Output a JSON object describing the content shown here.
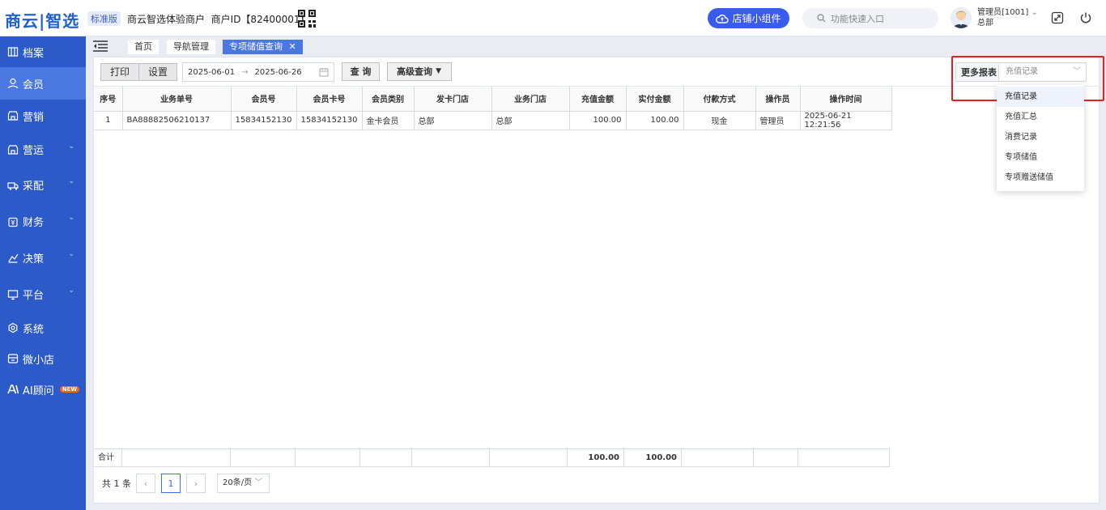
{
  "header": {
    "logo": "商云|智选",
    "edition": "标准版",
    "merchant_name": "商云智选体验商户",
    "merchant_id": "商户ID【82400001】",
    "shop_widget_label": "店铺小组件",
    "quick_search_placeholder": "功能快速入口",
    "user_name": "管理员[1001]",
    "user_dept": "总部"
  },
  "sidebar": {
    "items": [
      {
        "label": "档案",
        "icon": "archive-icon"
      },
      {
        "label": "会员",
        "icon": "user-icon",
        "active": true
      },
      {
        "label": "营销",
        "icon": "store-icon"
      },
      {
        "label": "营运",
        "icon": "store-icon",
        "expandable": true
      },
      {
        "label": "采配",
        "icon": "truck-icon",
        "expandable": true
      },
      {
        "label": "财务",
        "icon": "money-icon",
        "expandable": true
      },
      {
        "label": "决策",
        "icon": "chart-icon",
        "expandable": true
      },
      {
        "label": "平台",
        "icon": "monitor-icon",
        "expandable": true
      },
      {
        "label": "系统",
        "icon": "gear-icon"
      },
      {
        "label": "微小店",
        "icon": "shop-icon"
      },
      {
        "label": "AI顾问",
        "icon": "ai-icon",
        "badge": "NEW"
      }
    ]
  },
  "tabs": [
    {
      "label": "首页"
    },
    {
      "label": "导航管理"
    },
    {
      "label": "专项储值查询",
      "active": true
    }
  ],
  "toolbar": {
    "print_label": "打印",
    "settings_label": "设置",
    "date_start": "2025-06-01",
    "date_end": "2025-06-26",
    "query_label": "查 询",
    "advanced_label": "高级查询",
    "more_reports_label": "更多报表",
    "more_reports_value": "充值记录"
  },
  "report_options": [
    "充值记录",
    "充值汇总",
    "消费记录",
    "专项储值",
    "专项赠送储值"
  ],
  "table": {
    "columns": [
      "序号",
      "业务单号",
      "会员号",
      "会员卡号",
      "会员类别",
      "发卡门店",
      "业务门店",
      "充值金额",
      "实付金额",
      "付款方式",
      "操作员",
      "操作时间"
    ],
    "rows": [
      [
        "1",
        "BA88882506210137",
        "15834152130",
        "15834152130",
        "金卡会员",
        "总部",
        "总部",
        "100.00",
        "100.00",
        "现金",
        "管理员",
        "2025-06-21 12:21:56"
      ]
    ],
    "footer": {
      "label": "合计",
      "recharge_total": "100.00",
      "paid_total": "100.00"
    }
  },
  "pager": {
    "total": "共 1 条",
    "current_page": "1",
    "page_size": "20条/页"
  },
  "colors": {
    "primary": "#3a5bf0",
    "sidebar": "#2d5ac9",
    "highlight_box": "#e82020"
  }
}
